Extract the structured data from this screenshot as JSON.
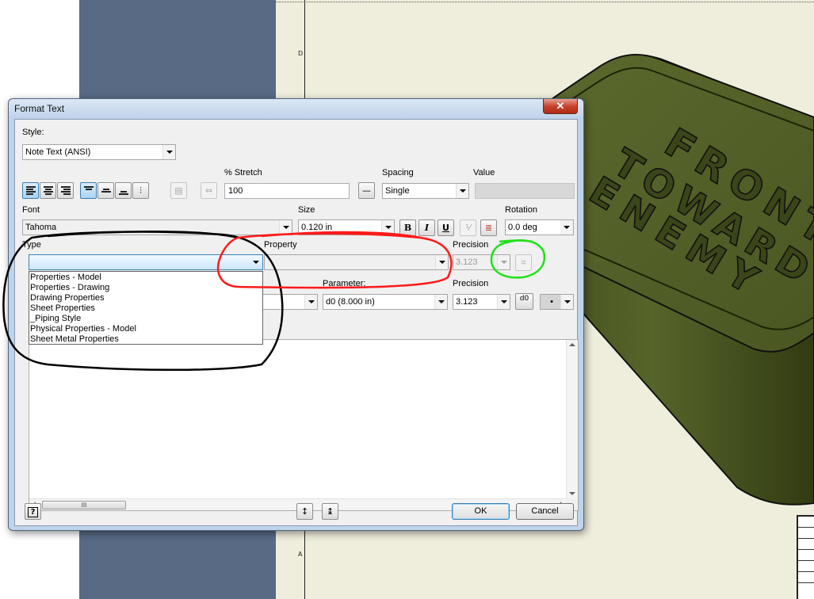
{
  "background": {
    "sheet_letters": [
      "D",
      "A"
    ]
  },
  "model": {
    "engraved_text": [
      "FRONT",
      "TOWARD",
      "ENEMY"
    ]
  },
  "dialog": {
    "title": "Format Text",
    "close_label": "✕",
    "style": {
      "label": "Style:",
      "value": "Note Text (ANSI)"
    },
    "stretch": {
      "label": "% Stretch",
      "value": "100"
    },
    "spacing": {
      "label": "Spacing",
      "value": "Single"
    },
    "value": {
      "label": "Value",
      "value": ""
    },
    "font": {
      "label": "Font",
      "value": "Tahoma"
    },
    "size": {
      "label": "Size",
      "value": "0.120 in"
    },
    "rotation": {
      "label": "Rotation",
      "value": "0.0 deg"
    },
    "format_buttons": {
      "bold": "B",
      "italic": "I",
      "underline": "U"
    },
    "type": {
      "label": "Type",
      "value": "",
      "options": [
        "Properties - Model",
        "Properties - Drawing",
        "Drawing Properties",
        "Sheet Properties",
        "_Piping Style",
        "Physical Properties - Model",
        "Sheet Metal Properties"
      ]
    },
    "property": {
      "label": "Property",
      "value": ""
    },
    "precision_top": {
      "label": "Precision",
      "value": "3.123"
    },
    "parameter": {
      "label": "Parameter:",
      "value": "d0 (8.000 in)"
    },
    "precision_bottom": {
      "label": "Precision",
      "value": "3.123"
    },
    "insert_param_label": "d0",
    "symbol_value": "•",
    "scroll_thumb_label": "III",
    "help_label": "?",
    "ok_label": "OK",
    "cancel_label": "Cancel"
  },
  "colors": {
    "dialog_frame": "#bfd3ea",
    "slate_panel": "#586a84",
    "drawing_sheet": "#efeedd",
    "model_green": "#4a5722",
    "annotation_black": "#000000",
    "annotation_red": "#ff1a1a",
    "annotation_green": "#22e01a"
  }
}
